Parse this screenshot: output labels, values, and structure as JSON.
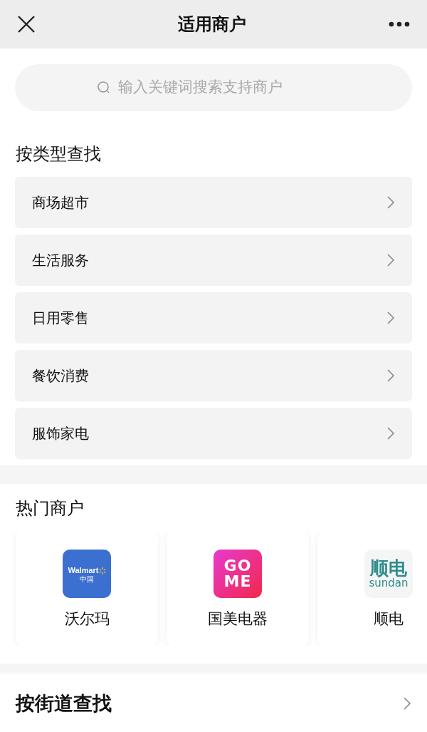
{
  "header": {
    "title": "适用商户"
  },
  "search": {
    "placeholder": "输入关键词搜索支持商户"
  },
  "by_type": {
    "title": "按类型查找",
    "items": [
      {
        "label": "商场超市"
      },
      {
        "label": "生活服务"
      },
      {
        "label": "日用零售"
      },
      {
        "label": "餐饮消费"
      },
      {
        "label": "服饰家电"
      }
    ]
  },
  "hot_merchants": {
    "title": "热门商户",
    "items": [
      {
        "name": "沃尔玛",
        "logo": {
          "kind": "walmart",
          "lines": [
            "Walmart",
            "中国"
          ]
        }
      },
      {
        "name": "国美电器",
        "logo": {
          "kind": "gome",
          "lines": [
            "GO",
            "ME"
          ]
        }
      },
      {
        "name": "顺电",
        "logo": {
          "kind": "sundan",
          "lines": [
            "顺电",
            "sundan"
          ]
        }
      }
    ]
  },
  "by_street": {
    "title": "按街道查找"
  }
}
